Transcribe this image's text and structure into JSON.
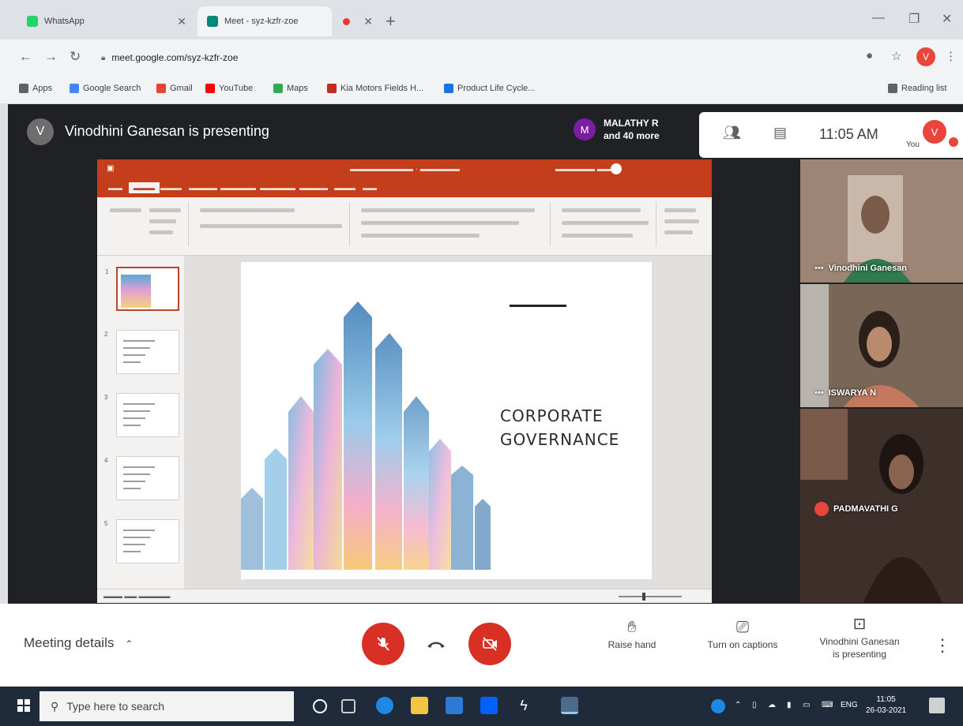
{
  "browser": {
    "tabs": [
      {
        "title": "WhatsApp",
        "color": "#25d366"
      },
      {
        "title": "Meet - syz-kzfr-zoe",
        "color": "#00897b"
      },
      {
        "title": "",
        "color": "#e53935"
      }
    ],
    "url": "meet.google.com/syz-kzfr-zoe",
    "bookmarks": [
      {
        "label": "Apps",
        "color": "#5f6368"
      },
      {
        "label": "Google Search",
        "color": "#4285f4"
      },
      {
        "label": "Gmail",
        "color": "#ea4335"
      },
      {
        "label": "YouTube",
        "color": "#ff0000"
      },
      {
        "label": "Maps",
        "color": "#34a853"
      },
      {
        "label": "Kia Motors Fields H...",
        "color": "#c62828"
      },
      {
        "label": "Product Life Cycle...",
        "color": "#1a73e8"
      }
    ],
    "reading_list": "Reading list",
    "profile_initial": "V"
  },
  "meet": {
    "presenter_initial": "V",
    "presenting_text": "Vinodhini Ganesan is presenting",
    "participant_initial": "M",
    "participant_line1": "MALATHY R",
    "participant_line2": "and 40 more",
    "clock": "11:05 AM",
    "self_label": "You",
    "self_initial": "V"
  },
  "slide": {
    "title": "CORPORATE\nGOVERNANCE",
    "thumb_count": 5
  },
  "tiles": [
    {
      "name": "Vinodhini Ganesan",
      "bg": "#8a7262"
    },
    {
      "name": "ISWARYA N",
      "bg": "#6e5a4d"
    },
    {
      "name": "PADMAVATHI G",
      "bg": "#4a3a33",
      "muted": true
    }
  ],
  "controls": {
    "meeting_details": "Meeting details",
    "raise_hand": "Raise hand",
    "captions": "Turn on captions",
    "presenting_line1": "Vinodhini Ganesan",
    "presenting_line2": "is presenting"
  },
  "taskbar": {
    "search_placeholder": "Type here to search",
    "lang": "ENG",
    "time": "11:05",
    "date": "26-03-2021"
  }
}
